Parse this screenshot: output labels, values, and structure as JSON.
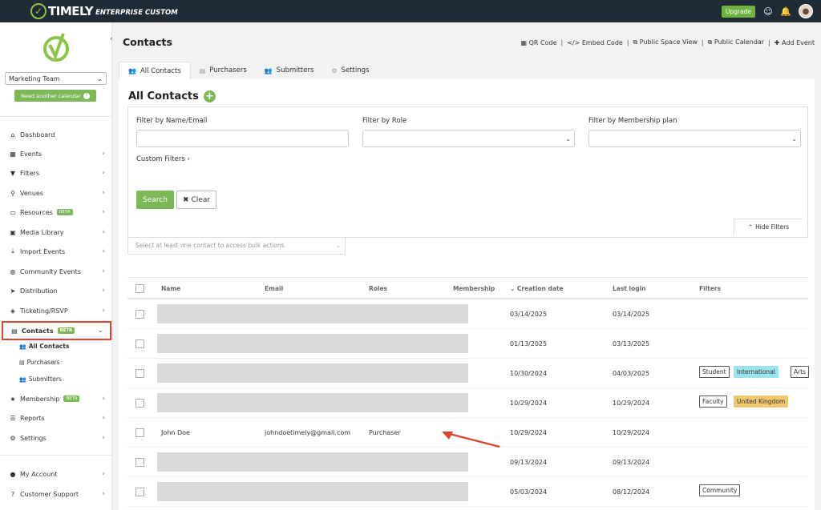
{
  "app": {
    "brand": "TIMELY",
    "edition": "ENTERPRISE CUSTOM",
    "upgrade_label": "Upgrade",
    "colors": {
      "topbar": "#1f2b35",
      "accent": "#7cb857",
      "highlight": "#d9462d"
    }
  },
  "sidebar": {
    "calendar_select": "Marketing Team",
    "need_calendar": "Need another calendar",
    "items": [
      {
        "label": "Dashboard",
        "icon": "home-icon"
      },
      {
        "label": "Events",
        "icon": "calendar-icon"
      },
      {
        "label": "Filters",
        "icon": "filter-icon"
      },
      {
        "label": "Venues",
        "icon": "map-pin-icon"
      },
      {
        "label": "Resources",
        "icon": "monitor-icon",
        "badge": "BETA"
      },
      {
        "label": "Media Library",
        "icon": "image-icon"
      },
      {
        "label": "Import Events",
        "icon": "download-icon"
      },
      {
        "label": "Community Events",
        "icon": "globe-icon"
      },
      {
        "label": "Distribution",
        "icon": "send-icon"
      },
      {
        "label": "Ticketing/RSVP",
        "icon": "ticket-icon"
      },
      {
        "label": "Contacts",
        "icon": "id-card-icon",
        "badge": "BETA"
      },
      {
        "label": "Membership",
        "icon": "star-icon",
        "badge": "BETA"
      },
      {
        "label": "Reports",
        "icon": "list-icon"
      },
      {
        "label": "Settings",
        "icon": "gears-icon"
      },
      {
        "label": "My Account",
        "icon": "user-icon"
      },
      {
        "label": "Customer Support",
        "icon": "question-icon"
      }
    ],
    "contacts_sub": [
      "All Contacts",
      "Purchasers",
      "Submitters"
    ]
  },
  "header": {
    "title": "Contacts",
    "actions": [
      "QR Code",
      "Embed Code",
      "Public Space View",
      "Public Calendar",
      "Add Event"
    ]
  },
  "tabs": [
    "All Contacts",
    "Purchasers",
    "Submitters",
    "Settings"
  ],
  "panel": {
    "title": "All Contacts",
    "filters": {
      "name_label": "Filter by Name/Email",
      "name_value": "",
      "role_label": "Filter by Role",
      "role_value": "",
      "plan_label": "Filter by Membership plan",
      "plan_value": "",
      "custom_filters": "Custom Filters",
      "search": "Search",
      "clear": "Clear",
      "hide": "Hide Filters"
    },
    "bulk_placeholder": "Select at least one contact to access bulk actions."
  },
  "table": {
    "columns": [
      "Name",
      "Email",
      "Roles",
      "Membership",
      "Creation date",
      "Last login",
      "Filters"
    ],
    "rows": [
      {
        "name": "",
        "email": "",
        "roles": "",
        "created": "03/14/2025",
        "login": "03/14/2025",
        "tags": [],
        "masked": true
      },
      {
        "name": "",
        "email": "",
        "roles": "",
        "created": "01/13/2025",
        "login": "03/13/2025",
        "tags": [],
        "masked": true
      },
      {
        "name": "",
        "email": "",
        "roles": "",
        "created": "10/30/2024",
        "login": "04/03/2025",
        "tags": [
          "Student",
          "International",
          "Arts"
        ],
        "masked": true
      },
      {
        "name": "",
        "email": "",
        "roles": "",
        "created": "10/29/2024",
        "login": "10/29/2024",
        "tags": [
          "Faculty",
          "United Kingdom"
        ],
        "masked": true
      },
      {
        "name": "John Doe",
        "email": "johndoetimely@gmail.com",
        "roles": "Purchaser",
        "created": "10/29/2024",
        "login": "10/29/2024",
        "tags": [],
        "masked": false
      },
      {
        "name": "",
        "email": "",
        "roles": "",
        "created": "09/13/2024",
        "login": "09/13/2024",
        "tags": [],
        "masked": true
      },
      {
        "name": "",
        "email": "",
        "roles": "",
        "created": "05/03/2024",
        "login": "08/12/2024",
        "tags": [
          "Community"
        ],
        "masked": true
      }
    ]
  }
}
